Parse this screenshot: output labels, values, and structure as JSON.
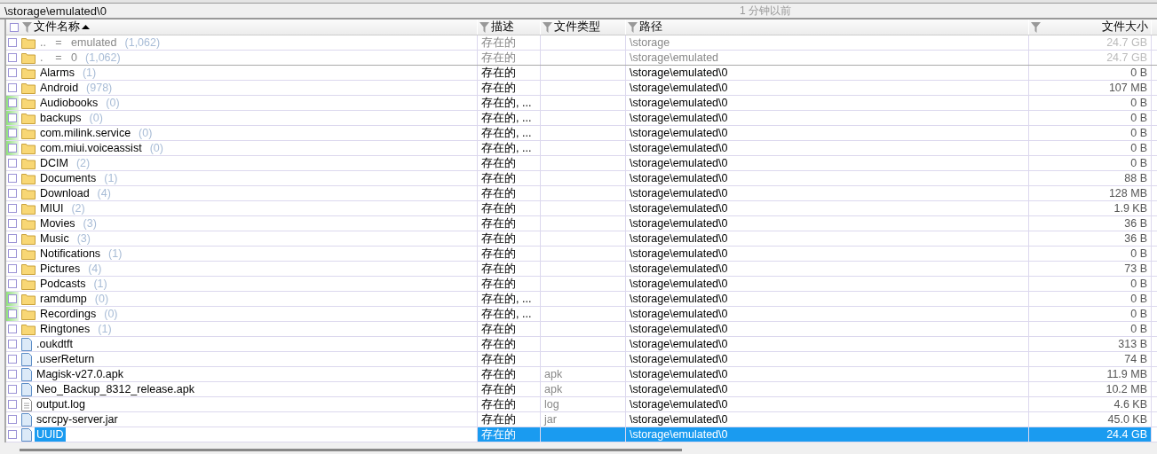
{
  "path_bar": {
    "path": "\\storage\\emulated\\0",
    "time": "1 分钟以前"
  },
  "table": {
    "all_checked": false,
    "columns": [
      {
        "label": "文件名称",
        "sorted": true
      },
      {
        "label": "描述"
      },
      {
        "label": "文件类型"
      },
      {
        "label": "路径"
      },
      {
        "label": "文件大小"
      }
    ],
    "rows": [
      {
        "kind": "folder",
        "name": "..   =   emulated",
        "count": "(1,062)",
        "checked": false,
        "dimmed": true,
        "marked": false,
        "selected": false,
        "desc": "存在的",
        "path": "\\storage",
        "size": "24.7 GB"
      },
      {
        "kind": "folder",
        "name": ".    =   0",
        "count": "(1,062)",
        "checked": false,
        "dimmed": true,
        "marked": false,
        "selected": false,
        "desc": "存在的",
        "path": "\\storage\\emulated",
        "size": "24.7 GB"
      },
      {
        "kind": "folder",
        "name": "Alarms",
        "count": "(1)",
        "checked": false,
        "dimmed": false,
        "marked": false,
        "selected": false,
        "desc": "存在的",
        "path": "\\storage\\emulated\\0",
        "size": "0 B"
      },
      {
        "kind": "folder",
        "name": "Android",
        "count": "(978)",
        "checked": false,
        "dimmed": false,
        "marked": false,
        "selected": false,
        "desc": "存在的",
        "path": "\\storage\\emulated\\0",
        "size": "107 MB"
      },
      {
        "kind": "folder",
        "name": "Audiobooks",
        "count": "(0)",
        "checked": false,
        "dimmed": false,
        "marked": true,
        "selected": false,
        "desc": "存在的, ...",
        "path": "\\storage\\emulated\\0",
        "size": "0 B"
      },
      {
        "kind": "folder",
        "name": "backups",
        "count": "(0)",
        "checked": false,
        "dimmed": false,
        "marked": true,
        "selected": false,
        "desc": "存在的, ...",
        "path": "\\storage\\emulated\\0",
        "size": "0 B"
      },
      {
        "kind": "folder",
        "name": "com.milink.service",
        "count": "(0)",
        "checked": false,
        "dimmed": false,
        "marked": true,
        "selected": false,
        "desc": "存在的, ...",
        "path": "\\storage\\emulated\\0",
        "size": "0 B"
      },
      {
        "kind": "folder",
        "name": "com.miui.voiceassist",
        "count": "(0)",
        "checked": false,
        "dimmed": false,
        "marked": true,
        "selected": false,
        "desc": "存在的, ...",
        "path": "\\storage\\emulated\\0",
        "size": "0 B"
      },
      {
        "kind": "folder",
        "name": "DCIM",
        "count": "(2)",
        "checked": false,
        "dimmed": false,
        "marked": false,
        "selected": false,
        "desc": "存在的",
        "path": "\\storage\\emulated\\0",
        "size": "0 B"
      },
      {
        "kind": "folder",
        "name": "Documents",
        "count": "(1)",
        "checked": false,
        "dimmed": false,
        "marked": false,
        "selected": false,
        "desc": "存在的",
        "path": "\\storage\\emulated\\0",
        "size": "88 B"
      },
      {
        "kind": "folder",
        "name": "Download",
        "count": "(4)",
        "checked": false,
        "dimmed": false,
        "marked": false,
        "selected": false,
        "desc": "存在的",
        "path": "\\storage\\emulated\\0",
        "size": "128 MB"
      },
      {
        "kind": "folder",
        "name": "MIUI",
        "count": "(2)",
        "checked": false,
        "dimmed": false,
        "marked": false,
        "selected": false,
        "desc": "存在的",
        "path": "\\storage\\emulated\\0",
        "size": "1.9 KB"
      },
      {
        "kind": "folder",
        "name": "Movies",
        "count": "(3)",
        "checked": false,
        "dimmed": false,
        "marked": false,
        "selected": false,
        "desc": "存在的",
        "path": "\\storage\\emulated\\0",
        "size": "36 B"
      },
      {
        "kind": "folder",
        "name": "Music",
        "count": "(3)",
        "checked": false,
        "dimmed": false,
        "marked": false,
        "selected": false,
        "desc": "存在的",
        "path": "\\storage\\emulated\\0",
        "size": "36 B"
      },
      {
        "kind": "folder",
        "name": "Notifications",
        "count": "(1)",
        "checked": false,
        "dimmed": false,
        "marked": false,
        "selected": false,
        "desc": "存在的",
        "path": "\\storage\\emulated\\0",
        "size": "0 B"
      },
      {
        "kind": "folder",
        "name": "Pictures",
        "count": "(4)",
        "checked": false,
        "dimmed": false,
        "marked": false,
        "selected": false,
        "desc": "存在的",
        "path": "\\storage\\emulated\\0",
        "size": "73 B"
      },
      {
        "kind": "folder",
        "name": "Podcasts",
        "count": "(1)",
        "checked": false,
        "dimmed": false,
        "marked": false,
        "selected": false,
        "desc": "存在的",
        "path": "\\storage\\emulated\\0",
        "size": "0 B"
      },
      {
        "kind": "folder",
        "name": "ramdump",
        "count": "(0)",
        "checked": false,
        "dimmed": false,
        "marked": true,
        "selected": false,
        "desc": "存在的, ...",
        "path": "\\storage\\emulated\\0",
        "size": "0 B"
      },
      {
        "kind": "folder",
        "name": "Recordings",
        "count": "(0)",
        "checked": false,
        "dimmed": false,
        "marked": true,
        "selected": false,
        "desc": "存在的, ...",
        "path": "\\storage\\emulated\\0",
        "size": "0 B"
      },
      {
        "kind": "folder",
        "name": "Ringtones",
        "count": "(1)",
        "checked": false,
        "dimmed": false,
        "marked": false,
        "selected": false,
        "desc": "存在的",
        "path": "\\storage\\emulated\\0",
        "size": "0 B"
      },
      {
        "kind": "file",
        "name": ".oukdtft",
        "checked": false,
        "dimmed": false,
        "marked": false,
        "selected": false,
        "desc": "存在的",
        "path": "\\storage\\emulated\\0",
        "size": "313 B"
      },
      {
        "kind": "file",
        "name": ".userReturn",
        "checked": false,
        "dimmed": false,
        "marked": false,
        "selected": false,
        "desc": "存在的",
        "path": "\\storage\\emulated\\0",
        "size": "74 B"
      },
      {
        "kind": "file",
        "name": "Magisk-v27.0.apk",
        "checked": false,
        "dimmed": false,
        "marked": false,
        "selected": false,
        "desc": "存在的",
        "type": "apk",
        "path": "\\storage\\emulated\\0",
        "size": "11.9 MB"
      },
      {
        "kind": "file",
        "name": "Neo_Backup_8312_release.apk",
        "checked": false,
        "dimmed": false,
        "marked": false,
        "selected": false,
        "desc": "存在的",
        "type": "apk",
        "path": "\\storage\\emulated\\0",
        "size": "10.2 MB"
      },
      {
        "kind": "text",
        "name": "output.log",
        "checked": false,
        "dimmed": false,
        "marked": false,
        "selected": false,
        "desc": "存在的",
        "type": "log",
        "path": "\\storage\\emulated\\0",
        "size": "4.6 KB"
      },
      {
        "kind": "file",
        "name": "scrcpy-server.jar",
        "checked": false,
        "dimmed": false,
        "marked": false,
        "selected": false,
        "desc": "存在的",
        "type": "jar",
        "path": "\\storage\\emulated\\0",
        "size": "45.0 KB"
      },
      {
        "kind": "file",
        "name": "UUID",
        "checked": false,
        "dimmed": false,
        "marked": false,
        "selected": true,
        "desc": "存在的",
        "path": "\\storage\\emulated\\0",
        "size": "24.4 GB"
      }
    ]
  }
}
